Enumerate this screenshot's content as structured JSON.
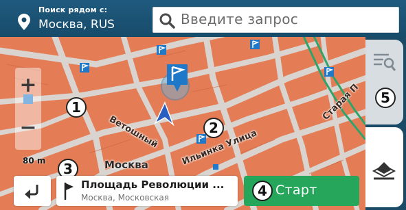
{
  "header": {
    "near_caption": "Поиск рядом с:",
    "near_value": "Москва, RUS",
    "search_placeholder": "Введите запрос"
  },
  "map": {
    "street_labels": [
      "Ветошный",
      "Ильинка Улица",
      "Старая П"
    ],
    "city_label": "Москва",
    "scale": "80 m"
  },
  "callouts": [
    "1",
    "2",
    "3",
    "4",
    "5"
  ],
  "destination": {
    "name": "Площадь Революции ...",
    "address": "Москва, Московская"
  },
  "actions": {
    "start_label": "Старт"
  },
  "colors": {
    "header_bg": "#1b4a66",
    "map_buildings": "#e47d56",
    "start_button": "#26a65b",
    "poi_marker": "#1f78c8"
  },
  "icons": [
    "location-pin-icon",
    "search-icon",
    "zoom-in-icon",
    "zoom-out-icon",
    "list-search-icon",
    "map-layers-icon",
    "back-arrow-icon",
    "destination-flag-icon",
    "poi-flag-icon",
    "vehicle-arrow-icon"
  ]
}
